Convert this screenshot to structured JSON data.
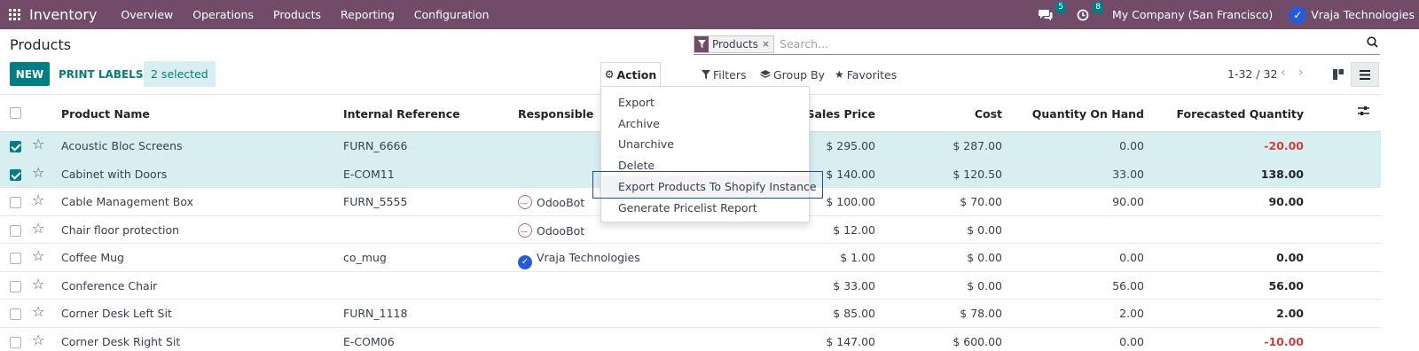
{
  "navbar": {
    "app_name": "Inventory",
    "menu": [
      "Overview",
      "Operations",
      "Products",
      "Reporting",
      "Configuration"
    ],
    "messages_count": "5",
    "activities_count": "8",
    "company": "My Company (San Francisco)",
    "user": "Vraja Technologies",
    "color": "#714b67"
  },
  "control": {
    "title": "Products",
    "new_label": "NEW",
    "print_labels": "PRINT LABELS",
    "selected_label": "2 selected",
    "action_label": "Action"
  },
  "search": {
    "facet": "Products",
    "facet_close": "×",
    "placeholder": "Search..."
  },
  "filters": {
    "filters_label": "Filters",
    "groupby_label": "Group By",
    "favorites_label": "Favorites"
  },
  "pager": {
    "text": "1-32 / 32"
  },
  "action_menu": {
    "items": [
      "Export",
      "Archive",
      "Unarchive",
      "Delete",
      "Export Products To Shopify Instance",
      "Generate Pricelist Report"
    ]
  },
  "table": {
    "columns": {
      "name": "Product Name",
      "ref": "Internal Reference",
      "responsible": "Responsible",
      "sales_price": "Sales Price",
      "cost": "Cost",
      "qty": "Quantity On Hand",
      "forecast": "Forecasted Quantity"
    },
    "rows": [
      {
        "selected": true,
        "name": "Acoustic Bloc Screens",
        "ref": "FURN_6666",
        "responsible": "",
        "resp_type": "",
        "price": "$ 295.00",
        "cost": "$ 287.00",
        "qty": "0.00",
        "forecast": "-20.00",
        "negative": true
      },
      {
        "selected": true,
        "name": "Cabinet with Doors",
        "ref": "E-COM11",
        "responsible": "",
        "resp_type": "",
        "price": "$ 140.00",
        "cost": "$ 120.50",
        "qty": "33.00",
        "forecast": "138.00",
        "negative": false
      },
      {
        "selected": false,
        "name": "Cable Management Box",
        "ref": "FURN_5555",
        "responsible": "OdooBot",
        "resp_type": "bot",
        "price": "$ 100.00",
        "cost": "$ 70.00",
        "qty": "90.00",
        "forecast": "90.00",
        "negative": false
      },
      {
        "selected": false,
        "name": "Chair floor protection",
        "ref": "",
        "responsible": "OdooBot",
        "resp_type": "bot",
        "price": "$ 12.00",
        "cost": "$ 0.00",
        "qty": "",
        "forecast": "",
        "negative": false
      },
      {
        "selected": false,
        "name": "Coffee Mug",
        "ref": "co_mug",
        "responsible": "Vraja Technologies",
        "resp_type": "vraja",
        "price": "$ 1.00",
        "cost": "$ 0.00",
        "qty": "0.00",
        "forecast": "0.00",
        "negative": false
      },
      {
        "selected": false,
        "name": "Conference Chair",
        "ref": "",
        "responsible": "",
        "resp_type": "",
        "price": "$ 33.00",
        "cost": "$ 0.00",
        "qty": "56.00",
        "forecast": "56.00",
        "negative": false
      },
      {
        "selected": false,
        "name": "Corner Desk Left Sit",
        "ref": "FURN_1118",
        "responsible": "",
        "resp_type": "",
        "price": "$ 85.00",
        "cost": "$ 78.00",
        "qty": "2.00",
        "forecast": "2.00",
        "negative": false
      },
      {
        "selected": false,
        "name": "Corner Desk Right Sit",
        "ref": "E-COM06",
        "responsible": "",
        "resp_type": "",
        "price": "$ 147.00",
        "cost": "$ 600.00",
        "qty": "0.00",
        "forecast": "-10.00",
        "negative": true
      }
    ]
  }
}
